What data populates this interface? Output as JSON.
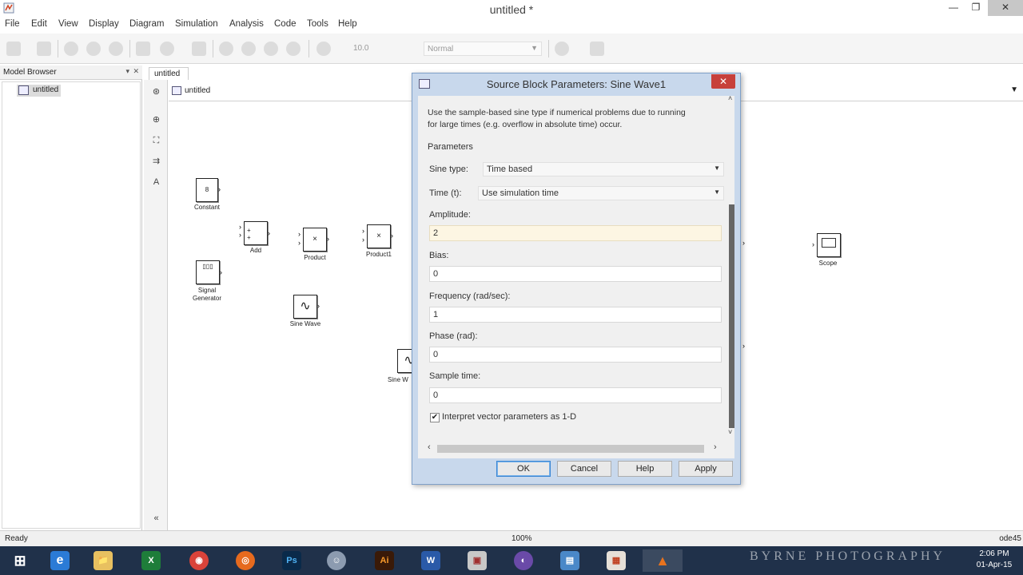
{
  "window": {
    "title": "untitled *",
    "controls": {
      "minimize": "—",
      "maximize": "❐",
      "close": "✕"
    }
  },
  "menu": [
    "File",
    "Edit",
    "View",
    "Display",
    "Diagram",
    "Simulation",
    "Analysis",
    "Code",
    "Tools",
    "Help"
  ],
  "toolbar": {
    "stop_time": "10.0",
    "sim_mode": "Normal"
  },
  "model_browser": {
    "title": "Model Browser",
    "items": [
      "untitled"
    ]
  },
  "tab": {
    "label": "untitled"
  },
  "address": {
    "path": "untitled"
  },
  "canvas": {
    "blocks": [
      {
        "name": "constant",
        "label": "Constant",
        "glyph": "8"
      },
      {
        "name": "signal-generator",
        "label": "Signal\nGenerator",
        "glyph": "▯▯▯"
      },
      {
        "name": "add",
        "label": "Add",
        "glyph": "+\n+"
      },
      {
        "name": "product",
        "label": "Product",
        "glyph": "×"
      },
      {
        "name": "product1",
        "label": "Product1",
        "glyph": "×"
      },
      {
        "name": "sine-wave",
        "label": "Sine Wave",
        "glyph": "∿"
      },
      {
        "name": "sine-wave1",
        "label": "Sine W",
        "glyph": "∿"
      },
      {
        "name": "scope",
        "label": "Scope",
        "glyph": "▭"
      }
    ]
  },
  "dialog": {
    "title": "Source Block Parameters: Sine Wave1",
    "close": "✕",
    "description_line1": "Use the sample-based sine type if numerical problems due to running",
    "description_line2": "for large times (e.g. overflow in absolute time) occur.",
    "section": "Parameters",
    "sine_type_label": "Sine type:",
    "sine_type_value": "Time based",
    "time_label": "Time (t):",
    "time_value": "Use simulation time",
    "fields": [
      {
        "label": "Amplitude:",
        "value": "2"
      },
      {
        "label": "Bias:",
        "value": "0"
      },
      {
        "label": "Frequency (rad/sec):",
        "value": "1"
      },
      {
        "label": "Phase (rad):",
        "value": "0"
      },
      {
        "label": "Sample time:",
        "value": "0"
      }
    ],
    "interpret_checked": "✔",
    "interpret_label": "Interpret vector parameters as 1-D",
    "buttons": {
      "ok": "OK",
      "cancel": "Cancel",
      "help": "Help",
      "apply": "Apply"
    }
  },
  "status": {
    "left": "Ready",
    "zoom": "100%",
    "solver": "ode45"
  },
  "taskbar": {
    "apps": [
      "⊞",
      "e",
      "📁",
      "X",
      "◉",
      "◎",
      "Ps",
      "☺",
      "Ai",
      "W",
      "▣",
      "◐",
      "▤",
      "▦",
      "▲"
    ],
    "time": "2:06 PM",
    "date": "01-Apr-15",
    "watermark": "BYRNE PHOTOGRAPHY"
  },
  "colors": {
    "dialog_frame": "#c8d8ec",
    "focus_field": "#fdf6e3",
    "close_red": "#c7403a",
    "taskbar": "#20314a"
  }
}
